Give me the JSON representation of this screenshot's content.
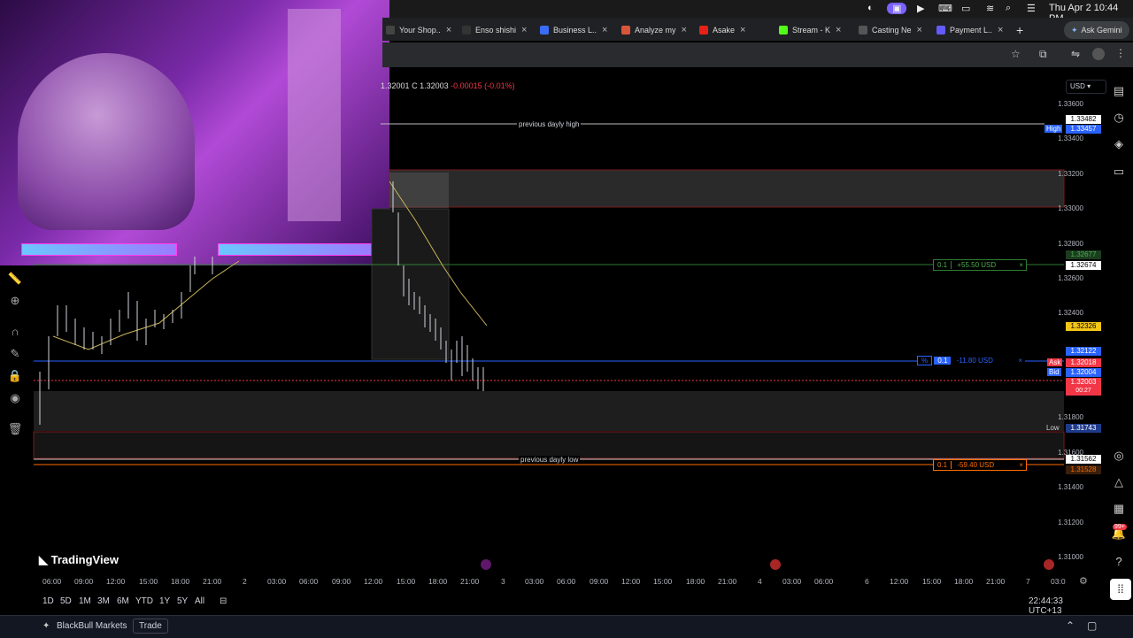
{
  "menubar": {
    "datetime": "Thu Apr 2  10:44 PM"
  },
  "tabs": [
    {
      "label": "Your Shop..",
      "color": "#444"
    },
    {
      "label": "Enso shishi",
      "color": "#333"
    },
    {
      "label": "Business L..",
      "color": "#3b6cf5"
    },
    {
      "label": "Analyze my",
      "color": "#d9553a"
    },
    {
      "label": "Asake",
      "color": "#e62117"
    },
    {
      "label": "Stream - K",
      "color": "#53fc18"
    },
    {
      "label": "Casting Ne",
      "color": "#555"
    },
    {
      "label": "Payment L..",
      "color": "#635bff"
    }
  ],
  "ask_gemini": "Ask Gemini",
  "ohlc": {
    "partial": "1.32001",
    "c_label": "C",
    "c_value": "1.32003",
    "change": "-0.00015 (-0.01%)"
  },
  "currency": "USD",
  "levels": {
    "prev_high": "previous dayly high",
    "prev_low": "previous dayly low",
    "tp_label": "0.1",
    "tp_value": "+55.50 USD",
    "pos_label": "0.1",
    "pos_value": "-11.80 USD",
    "pos_pct": "%",
    "sl_label": "0.1",
    "sl_value": "-59.40 USD"
  },
  "price_axis": [
    "1.33600",
    "1.33400",
    "1.33200",
    "1.33000",
    "1.32800",
    "1.32600",
    "1.32400",
    "1.31800",
    "1.31600",
    "1.31400",
    "1.31200",
    "1.31000"
  ],
  "price_tags": {
    "high_val": "1.33482",
    "high_label": "High",
    "high_tag": "1.33457",
    "tp1": "1.32677",
    "tp2": "1.32674",
    "yellow": "1.32326",
    "blue": "1.32122",
    "ask_label": "Ask",
    "ask": "1.32018",
    "bid_label": "Bid",
    "bid": "1.32004",
    "last": "1.32003",
    "countdown": "00:27",
    "low_label": "Low",
    "low": "1.31743",
    "sl1": "1.31562",
    "sl2": "1.31528"
  },
  "time_axis": [
    "06:00",
    "09:00",
    "12:00",
    "15:00",
    "18:00",
    "21:00",
    "2",
    "03:00",
    "06:00",
    "09:00",
    "12:00",
    "15:00",
    "18:00",
    "21:00",
    "3",
    "03:00",
    "06:00",
    "09:00",
    "12:00",
    "15:00",
    "18:00",
    "21:00",
    "4",
    "03:00",
    "06:00",
    "6",
    "12:00",
    "15:00",
    "18:00",
    "21:00",
    "7",
    "03:0"
  ],
  "brand": "TradingView",
  "ranges": [
    "1D",
    "5D",
    "1M",
    "3M",
    "6M",
    "YTD",
    "1Y",
    "5Y",
    "All"
  ],
  "clock": "22:44:33 UTC+13",
  "broker": "BlackBull Markets",
  "trade_button": "Trade",
  "notif_badge": "99+"
}
